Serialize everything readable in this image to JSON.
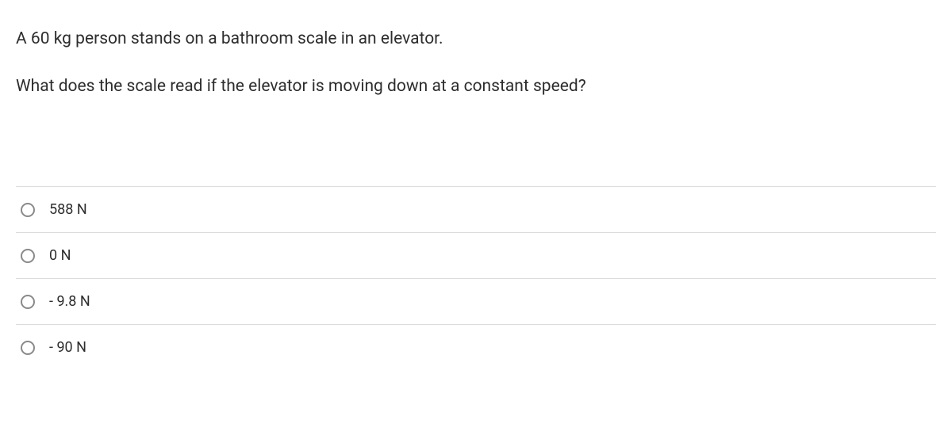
{
  "question": {
    "line1": "A 60 kg person stands on a bathroom scale in an elevator.",
    "line2": "What does the scale read if the elevator is moving down at a constant speed?"
  },
  "options": [
    {
      "label": "588 N"
    },
    {
      "label": "0 N"
    },
    {
      "label": "- 9.8 N"
    },
    {
      "label": "- 90 N"
    }
  ]
}
